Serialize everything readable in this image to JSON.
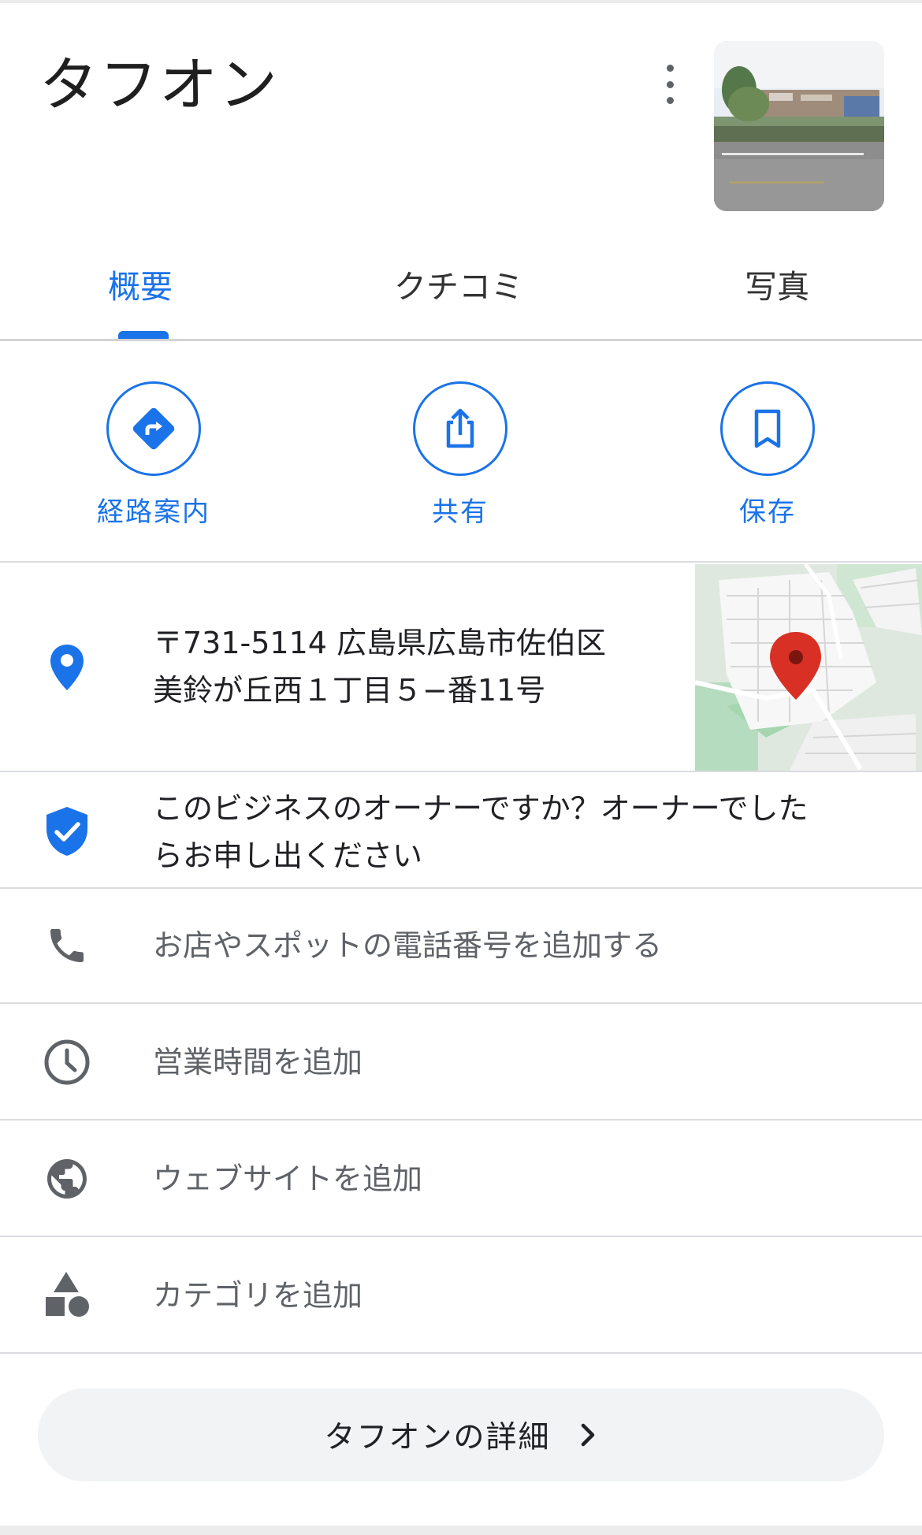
{
  "place": {
    "name": "タフオン",
    "more_icon": "more-vert-icon"
  },
  "tabs": [
    {
      "label": "概要",
      "active": true
    },
    {
      "label": "クチコミ",
      "active": false
    },
    {
      "label": "写真",
      "active": false
    }
  ],
  "actions": [
    {
      "label": "経路案内",
      "icon": "directions-icon"
    },
    {
      "label": "共有",
      "icon": "share-icon"
    },
    {
      "label": "保存",
      "icon": "bookmark-icon"
    }
  ],
  "address": {
    "line1": "〒731-5114 広島県広島市佐伯区",
    "line2": "美鈴が丘西１丁目５−番11号"
  },
  "owner_prompt": {
    "line1": "このビジネスのオーナーですか？オーナーでした",
    "line2": "らお申し出ください"
  },
  "rows": {
    "phone": "お店やスポットの電話番号を追加する",
    "hours": "営業時間を追加",
    "website": "ウェブサイトを追加",
    "category": "カテゴリを追加"
  },
  "details_button": "タフオンの詳細",
  "colors": {
    "accent": "#1a73e8",
    "pin_red": "#d93025",
    "icon_gray": "#5f6368"
  }
}
